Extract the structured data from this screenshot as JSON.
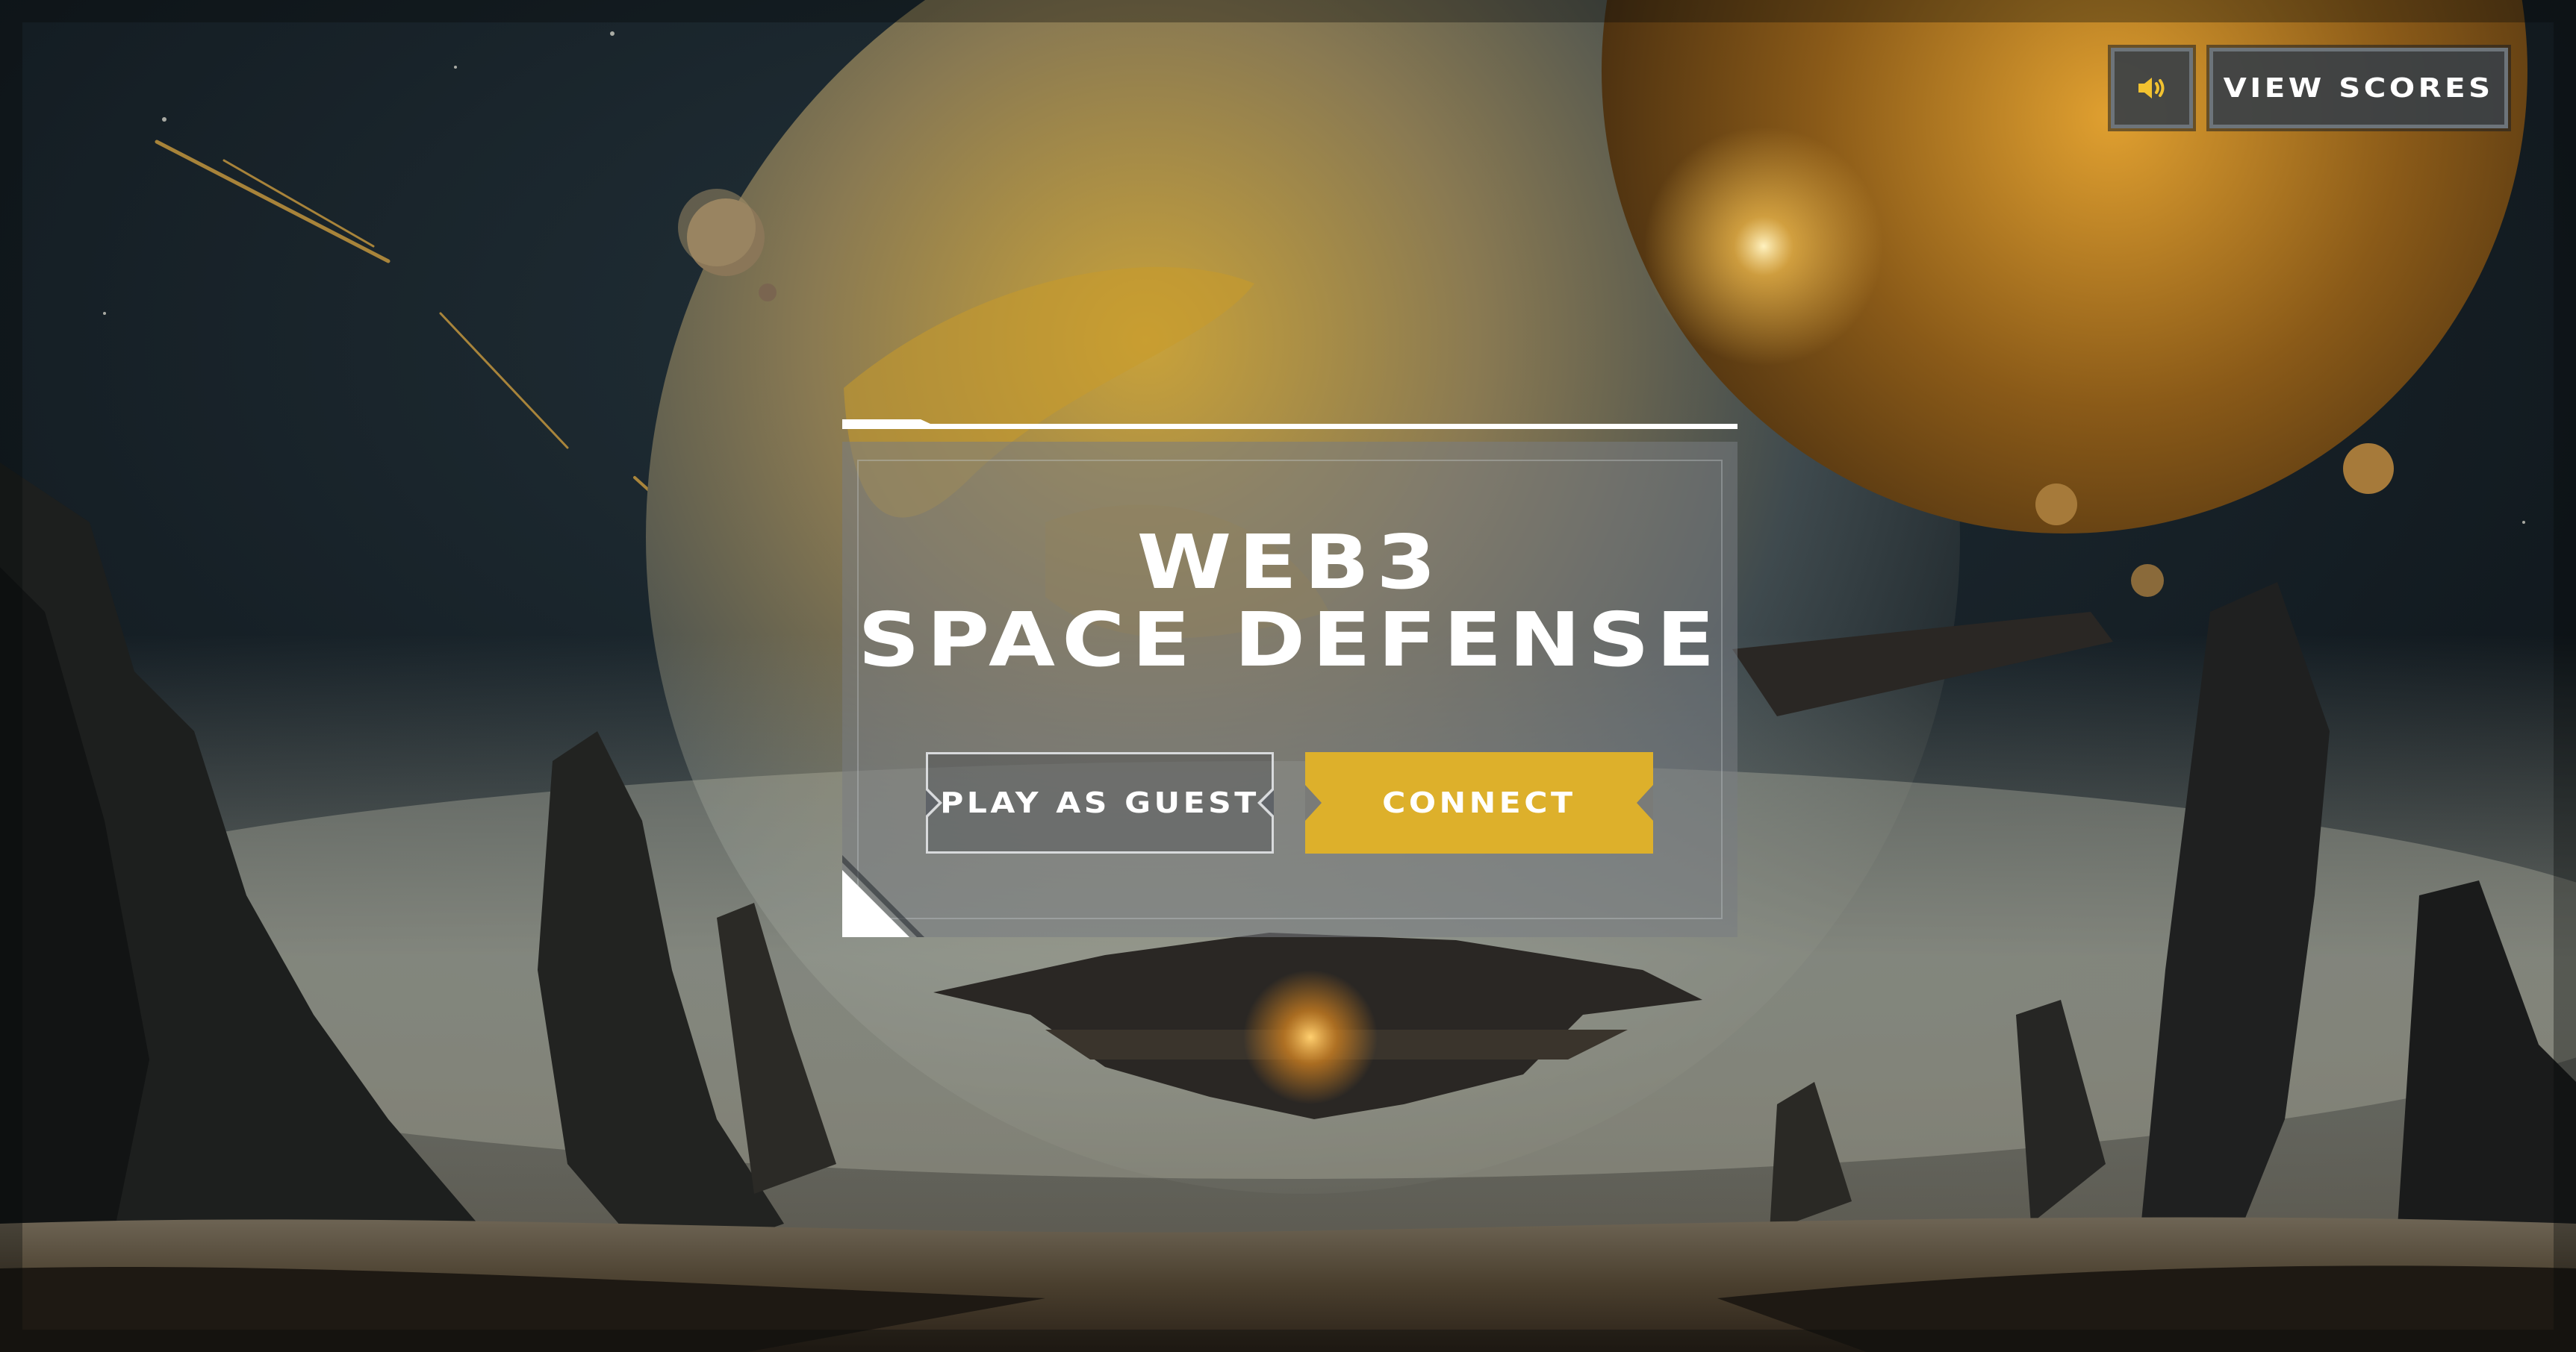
{
  "game": {
    "title_line_1": "WEB3",
    "title_line_2": "SPACE DEFENSE"
  },
  "hud": {
    "sound_icon": "speaker-icon",
    "view_scores_label": "VIEW SCORES"
  },
  "menu": {
    "guest_label": "PLAY AS GUEST",
    "connect_label": "CONNECT"
  },
  "colors": {
    "accent": "#ddb02b",
    "panel_border": "#d8dadc",
    "hud_border": "#6d747a",
    "text": "#ffffff"
  }
}
